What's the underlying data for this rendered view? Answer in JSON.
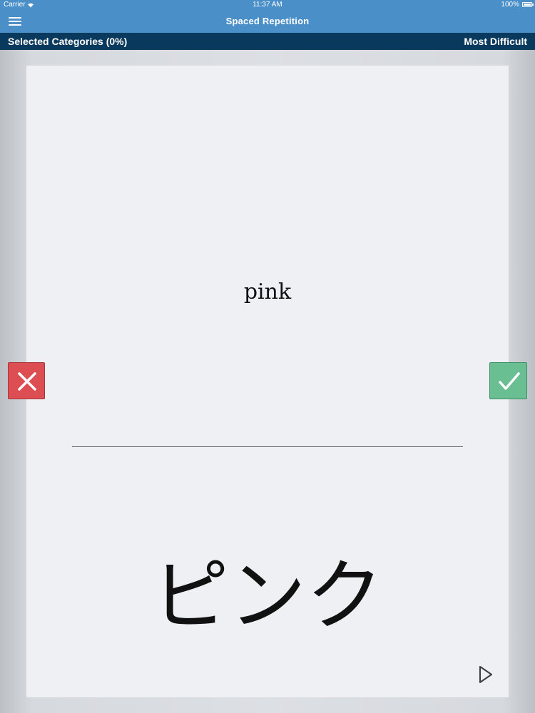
{
  "status_bar": {
    "carrier": "Carrier",
    "time": "11:37 AM",
    "battery": "100%",
    "icons": [
      "wifi-icon",
      "battery-icon"
    ]
  },
  "nav": {
    "title": "Spaced Repetition",
    "menu_icon": "hamburger-menu-icon"
  },
  "sub_bar": {
    "left": "Selected Categories (0%)",
    "right": "Most Difficult"
  },
  "card": {
    "front": "pink",
    "back": "ピンク"
  },
  "buttons": {
    "wrong_icon": "x-icon",
    "right_icon": "checkmark-icon",
    "play_icon": "play-icon"
  },
  "colors": {
    "nav_bg": "#4a8fc8",
    "sub_bar_bg": "#093a5e",
    "card_bg": "#eef0f3",
    "wrong": "#dd4e52",
    "right": "#69be92"
  }
}
